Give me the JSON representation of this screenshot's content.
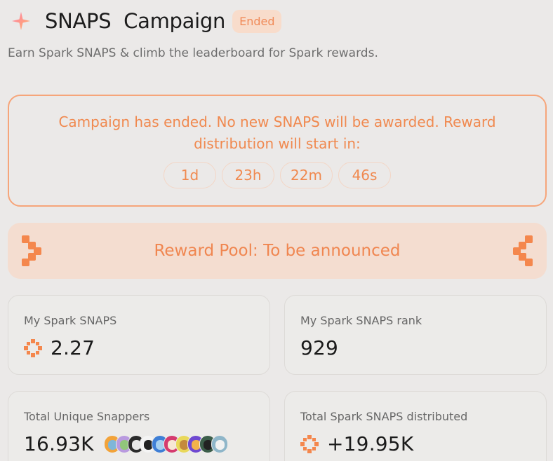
{
  "header": {
    "title": "SNAPS  Campaign",
    "status_badge": "Ended",
    "subtitle": "Earn Spark SNAPS & climb the leaderboard for Spark rewards."
  },
  "notice": {
    "message": "Campaign has ended. No new SNAPS will be awarded. Reward distribution will start in:",
    "countdown": {
      "days": "1d",
      "hours": "23h",
      "minutes": "22m",
      "seconds": "46s"
    }
  },
  "reward_pool": {
    "label": "Reward Pool: To be announced"
  },
  "stats": {
    "my_snaps": {
      "label": "My Spark SNAPS",
      "value": "2.27"
    },
    "my_rank": {
      "label": "My Spark SNAPS rank",
      "value": "929"
    },
    "unique_snappers": {
      "label": "Total Unique Snappers",
      "value": "16.93K"
    },
    "total_distributed": {
      "label": "Total Spark SNAPS distributed",
      "value": "+19.95K"
    }
  },
  "colors": {
    "accent": "#f08a58",
    "accent_light": "#f8dccb",
    "background": "#ebe9e8"
  },
  "avatars": [
    {
      "bg": "#f2a33a",
      "face": "#7fb6d8"
    },
    {
      "bg": "#b99adf",
      "face": "#91c67b"
    },
    {
      "bg": "#2b2b2b",
      "face": "#e8e8e8"
    },
    {
      "bg": "#f4f4f4",
      "face": "#222222"
    },
    {
      "bg": "#3f7fd6",
      "face": "#a6d0f0"
    },
    {
      "bg": "#d53b6f",
      "face": "#f7e7d5"
    },
    {
      "bg": "#e9d85a",
      "face": "#c48a3c"
    },
    {
      "bg": "#6f49d1",
      "face": "#f2b34a"
    },
    {
      "bg": "#3c5e4a",
      "face": "#222222"
    },
    {
      "bg": "#8fb6c9",
      "face": "#f1f1f1"
    }
  ]
}
